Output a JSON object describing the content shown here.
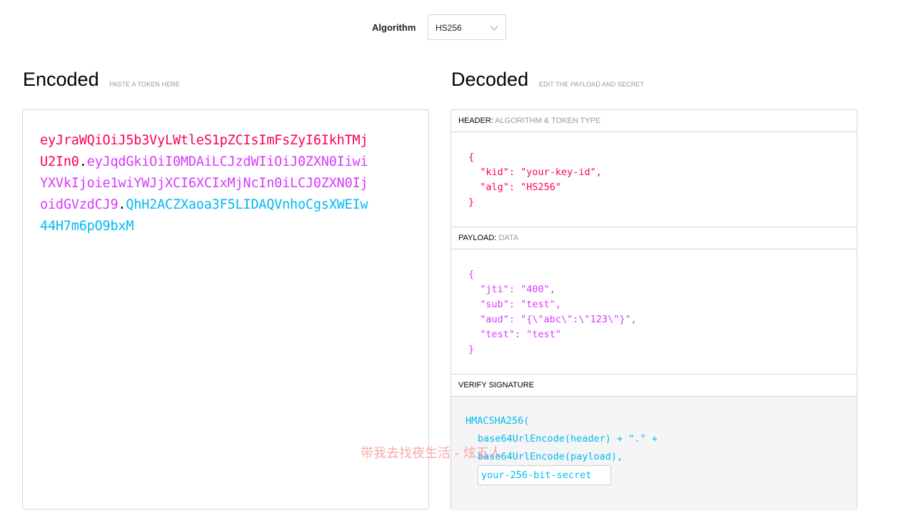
{
  "algorithm": {
    "label": "Algorithm",
    "selected": "HS256"
  },
  "encoded": {
    "title": "Encoded",
    "hint": "PASTE A TOKEN HERE",
    "token_header": "eyJraWQiOiJ5b3VyLWtleS1pZCIsImFsZyI6IkhTMjU2In0",
    "token_payload": "eyJqdGkiOiI0MDAiLCJzdWIiOiJ0ZXN0IiwiYXVkIjoie1wiYWJjXCI6XCIxMjNcIn0iLCJ0ZXN0IjoidGVzdCJ9",
    "token_signature": "QhH2ACZXaoa3F5LIDAQVnhoCgsXWEIw44H7m6pO9bxM",
    "dot": "."
  },
  "decoded": {
    "title": "Decoded",
    "hint": "EDIT THE PAYLOAD AND SECRET",
    "header_section": {
      "label": "HEADER:",
      "desc": "ALGORITHM & TOKEN TYPE",
      "json": "{\n  \"kid\": \"your-key-id\",\n  \"alg\": \"HS256\"\n}"
    },
    "payload_section": {
      "label": "PAYLOAD:",
      "desc": "DATA",
      "json": "{\n  \"jti\": \"400\",\n  \"sub\": \"test\",\n  \"aud\": \"{\\\"abc\\\":\\\"123\\\"}\",\n  \"test\": \"test\"\n}"
    },
    "verify_section": {
      "label": "VERIFY SIGNATURE",
      "fn": "HMACSHA256(",
      "line1": "base64UrlEncode(header) + \".\" +",
      "line2": "base64UrlEncode(payload),",
      "secret_placeholder": "your-256-bit-secret"
    }
  },
  "watermark": "带我去找夜生活 - 炫五人",
  "colors": {
    "header": "#fb015b",
    "payload": "#d63aff",
    "signature": "#00b9f1"
  }
}
